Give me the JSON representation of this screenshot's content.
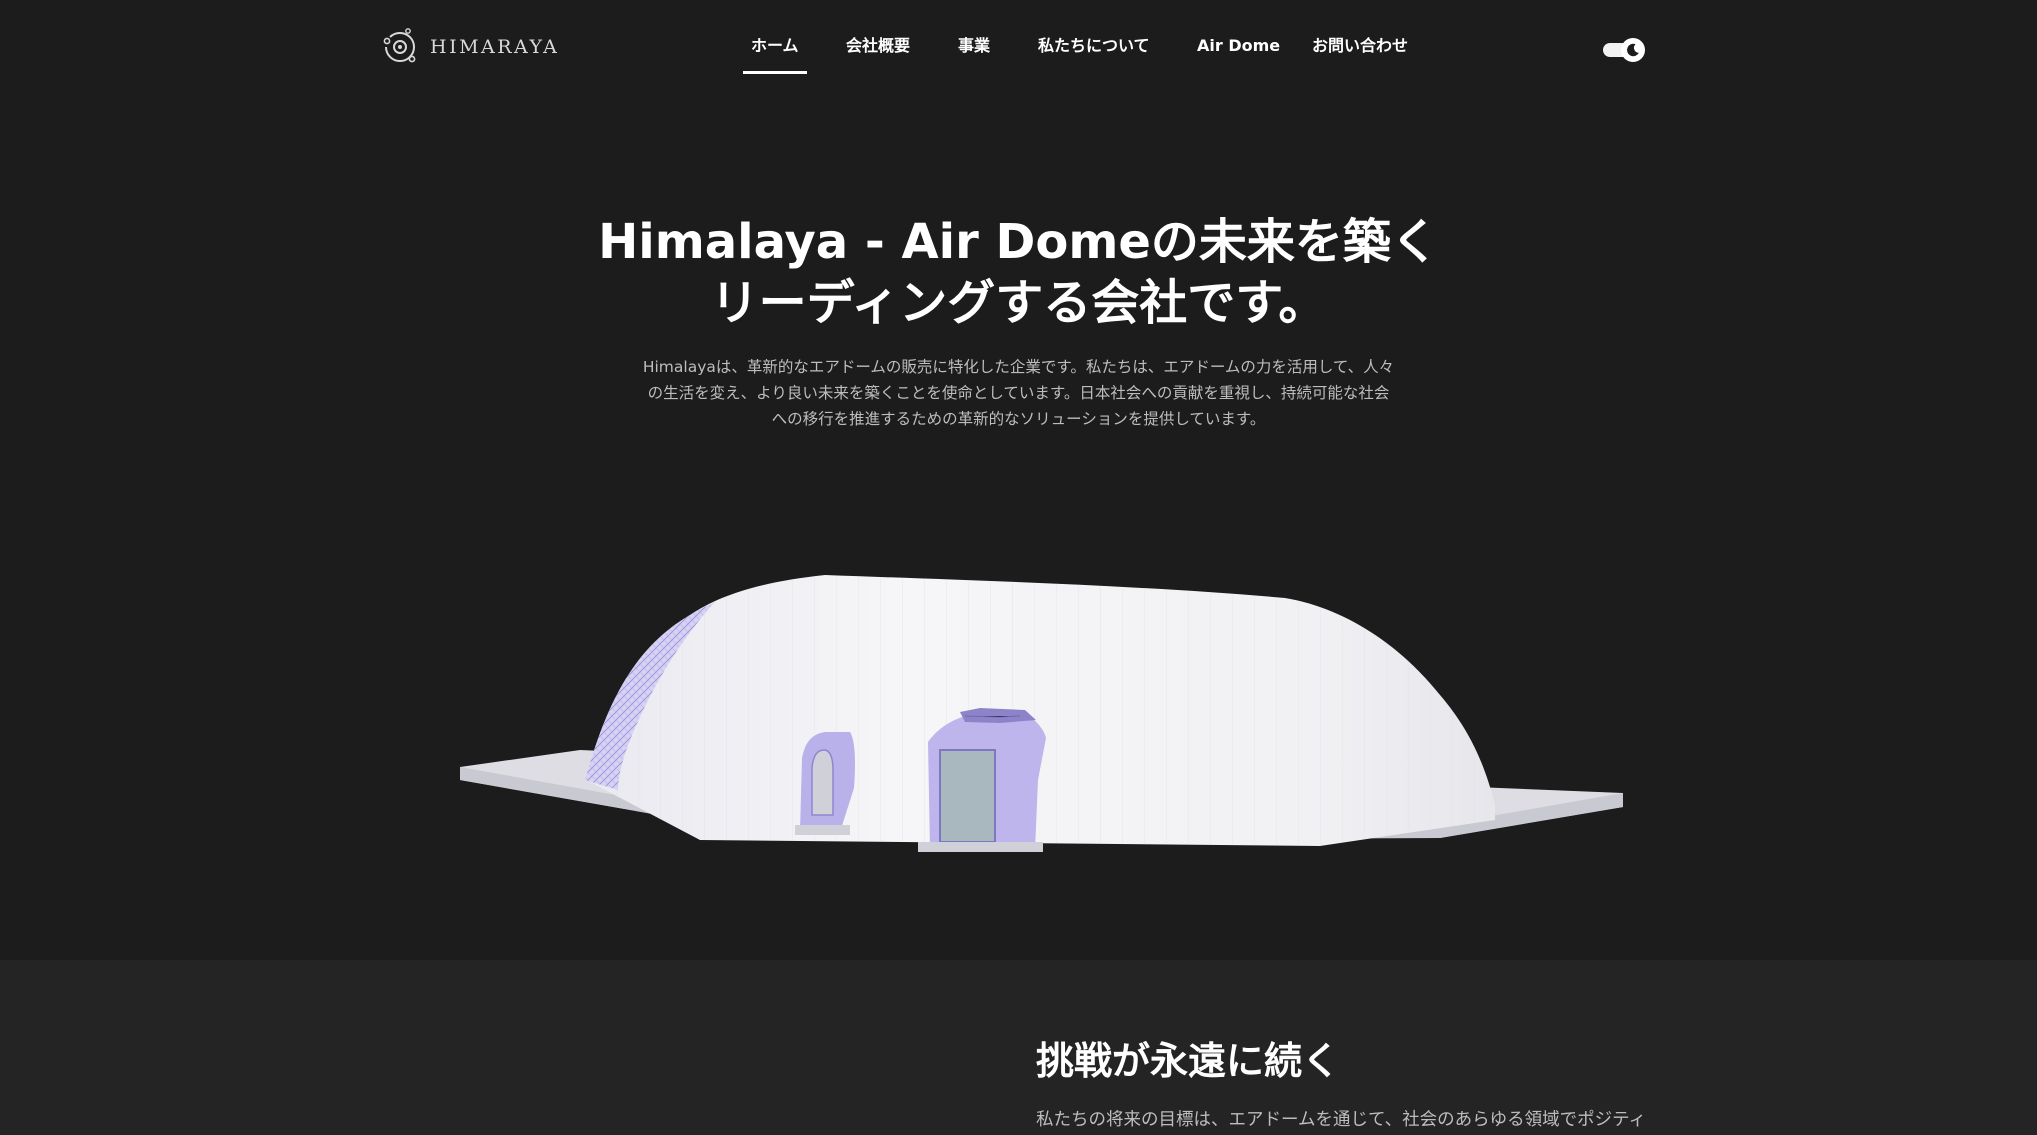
{
  "header": {
    "logo_text": "HIMARAYA",
    "nav": [
      {
        "label": "ホーム",
        "active": true
      },
      {
        "label": "会社概要",
        "active": false
      },
      {
        "label": "事業",
        "active": false
      },
      {
        "label": "私たちについて",
        "active": false
      },
      {
        "label": "Air Dome",
        "active": false
      },
      {
        "label": "お問い合わせ",
        "active": false
      }
    ],
    "theme_toggle_icon": "moon-icon"
  },
  "hero": {
    "title_line1": "Himalaya - Air Domeの未来を築く",
    "title_line2": "リーディングする会社です。",
    "description": "Himalayaは、革新的なエアドームの販売に特化した企業です。私たちは、エアドームの力を活用して、人々の生活を変え、より良い未来を築くことを使命としています。日本社会への貢献を重視し、持続可能な社会への移行を推進するための革新的なソリューションを提供しています。"
  },
  "section2": {
    "title": "挑戦が永遠に続く",
    "text": "私たちの将来の目標は、エアドームを通じて、社会のあらゆる領域でポジティ"
  },
  "colors": {
    "background": "#1c1c1d",
    "section_background": "#242425",
    "dome_white": "#f4f4f6",
    "dome_accent": "#a89de0"
  }
}
